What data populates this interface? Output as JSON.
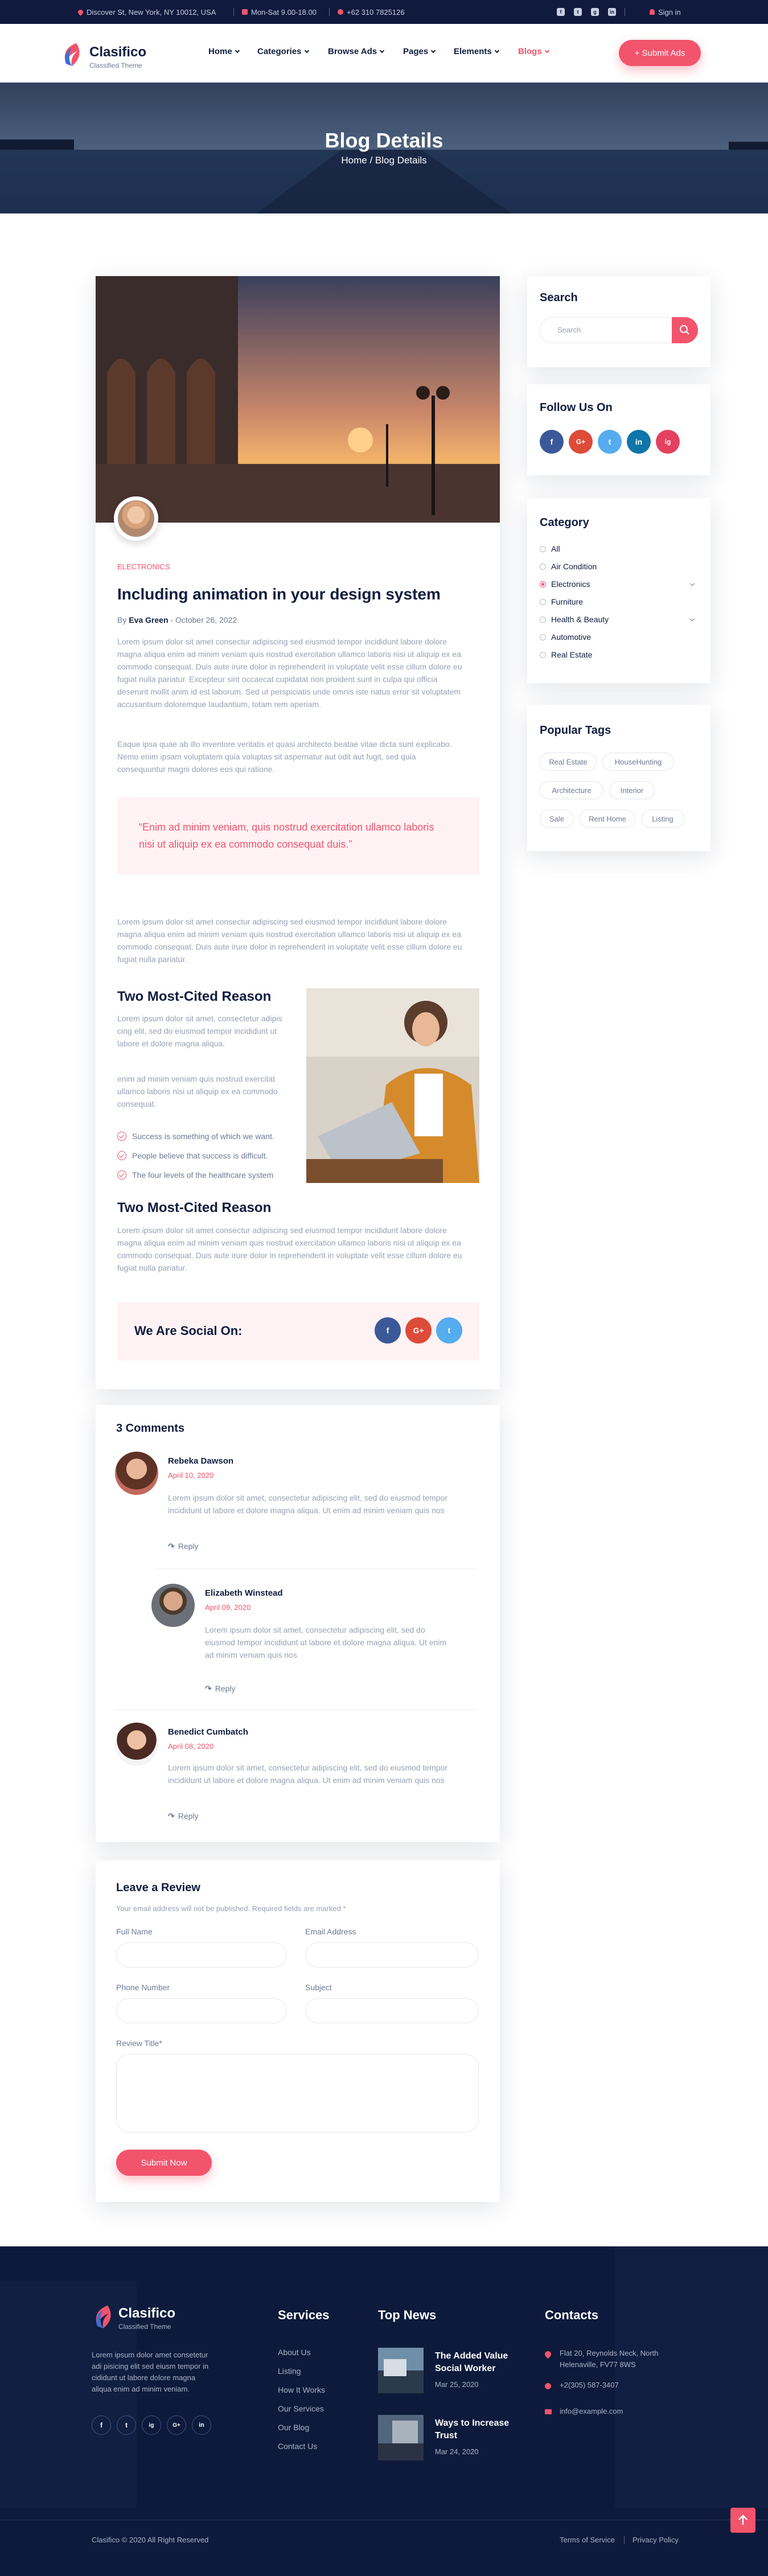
{
  "topbar": {
    "address": "Discover St, New York, NY 10012, USA",
    "hours": "Mon-Sat 9.00-18.00",
    "phone": "+62 310 7825126",
    "signin": "Sign in",
    "social": [
      "f",
      "t",
      "g",
      "in"
    ]
  },
  "brand": {
    "name": "Clasifico",
    "tagline": "Classified Theme"
  },
  "nav": {
    "items": [
      {
        "label": "Home",
        "active": false
      },
      {
        "label": "Categories",
        "active": false
      },
      {
        "label": "Browse Ads",
        "active": false
      },
      {
        "label": "Pages",
        "active": false
      },
      {
        "label": "Elements",
        "active": false
      },
      {
        "label": "Blogs",
        "active": true
      }
    ],
    "submit_label": "+ Submit Ads"
  },
  "banner": {
    "title": "Blog Details",
    "crumb_home": "Home",
    "crumb_sep": "/",
    "crumb_current": "Blog Details"
  },
  "post": {
    "category": "ELECTRONICS",
    "title": "Including animation in your design system",
    "by": "By",
    "author": "Eva Green",
    "date": " - October 26, 2022",
    "para1_lines": [
      "Lorem ipsum dolor sit amet consectur adipiscing sed eiusmod tempor incididunt labore dolore",
      "magna aliqua enim ad minim veniam quis nostrud exercitation ullamco laboris nisi ut aliquip ex ea",
      "commodo consequat. Duis aute irure dolor in reprehenderit in voluptate velit esse cillum dolore eu",
      "fugiat nulla pariatur. Excepteur sint occaecat cupidatat non proident sunt in culpa qui officia",
      "deserunt mollit anim id est laborum. Sed ut perspiciatis unde omnis iste natus error sit voluptatem",
      "accusantium doloremque laudantium, totam rem aperiam."
    ],
    "para2_lines": [
      "Eaque ipsa quae ab illo inventore veritatis et quasi architecto beatae vitae dicta sunt explicabo.",
      "Nemo enim ipsam voluptatem quia voluptas sit aspernatur aut odit aut fugit, sed quia",
      "consequuntur magni dolores eos qui ratione."
    ],
    "quote_lines": [
      "“Enim ad minim veniam, quis nostrud exercitation ullamco laboris",
      "nisi ut aliquip ex ea commodo consequat duis.”"
    ],
    "para3_lines": [
      "Lorem ipsum dolor sit amet consectur adipiscing sed eiusmod tempor incididunt labore dolore",
      "magna aliqua enim ad minim veniam quis nostrud exercitation ullamco laboris nisi ut aliquip ex ea",
      "commodo consequat. Duis aute irure dolor in reprehenderit in voluptate velit esse cillum dolore eu",
      "fugiat nulla pariatur."
    ],
    "section1_title": "Two Most-Cited Reason",
    "section1_p1": [
      "Lorem ipsum dolor sit amet, consectetur adipis",
      "cing elit, sed do eiusmod tempor incididunt ut",
      "labore et dolore magna aliqua."
    ],
    "section1_p2": [
      "enim ad minim veniam quis nostrud exercitat",
      "ullamco laboris nisi ut aliquip ex ea commodo",
      "consequat."
    ],
    "checks": [
      "Success is something of which we want.",
      "People believe that success is difficult.",
      "The four levels of the healthcare system"
    ],
    "section2_title": "Two Most-Cited Reason",
    "para4_lines": [
      "Lorem ipsum dolor sit amet consectur adipiscing sed eiusmod tempor incididunt labore dolore",
      "magna aliqua enim ad minim veniam quis nostrud exercitation ullamco laboris nisi ut aliquip ex ea",
      "commodo consequat. Duis aute irure dolor in reprehenderit in voluptate velit esse cillum dolore eu",
      "fugiat nulla pariatur."
    ],
    "social_title": "We Are Social On:",
    "social": [
      "f",
      "G+",
      "t"
    ]
  },
  "comments": {
    "title": "3 Comments",
    "reply": "Reply",
    "items": [
      {
        "name": "Rebeka Dawson",
        "date": "April 10, 2020",
        "lines": [
          "Lorem ipsum dolor sit amet, consectetur adipiscing elit, sed do eiusmod tempor",
          "incididunt ut labore et dolore magna aliqua. Ut enim ad minim veniam quis nos"
        ]
      },
      {
        "name": "Elizabeth Winstead",
        "date": "April 09, 2020",
        "lines": [
          "Lorem ipsum dolor sit amet, consectetur adipiscing elit, sed do",
          "eiusmod tempor incididunt ut labore et dolore magna aliqua. Ut enim",
          "ad minim veniam quis nos"
        ]
      },
      {
        "name": "Benedict Cumbatch",
        "date": "April 08, 2020",
        "lines": [
          "Lorem ipsum dolor sit amet, consectetur adipiscing elit, sed do eiusmod tempor",
          "incididunt ut labore et dolore magna aliqua. Ut enim ad minim veniam quis nos"
        ]
      }
    ]
  },
  "review": {
    "title": "Leave a Review",
    "note": "Your email address will not be published. Required fields are marked *",
    "full_name": "Full Name",
    "email": "Email Address",
    "phone": "Phone Number",
    "subject": "Subject",
    "review_title": "Review Title*",
    "submit": "Submit Now"
  },
  "sidebar": {
    "search_title": "Search",
    "search_placeholder": "Search",
    "follow_title": "Follow Us On",
    "follow": [
      "f",
      "G+",
      "t",
      "in",
      "ig"
    ],
    "category_title": "Category",
    "categories": [
      {
        "label": "All",
        "active": false,
        "arrow": false
      },
      {
        "label": "Air Condition",
        "active": false,
        "arrow": false
      },
      {
        "label": "Electronics",
        "active": true,
        "arrow": true
      },
      {
        "label": "Furniture",
        "active": false,
        "arrow": false
      },
      {
        "label": "Health & Beauty",
        "active": false,
        "arrow": true
      },
      {
        "label": "Automotive",
        "active": false,
        "arrow": false
      },
      {
        "label": "Real Estate",
        "active": false,
        "arrow": false
      }
    ],
    "tags_title": "Popular Tags",
    "tags": [
      "Real Estate",
      "HouseHunting",
      "Architecture",
      "Interior",
      "Sale",
      "Rent Home",
      "Listing"
    ]
  },
  "footer": {
    "about": [
      "Lorem ipsum dolor amet consetetur",
      "adi pisicing elit sed eiusm tempor in",
      "cididunt ut labore dolore magna",
      "aliqua enim ad minim veniam."
    ],
    "social": [
      "f",
      "t",
      "ig",
      "G+",
      "in"
    ],
    "services_title": "Services",
    "services": [
      "About Us",
      "Listing",
      "How It Works",
      "Our Services",
      "Our Blog",
      "Contact Us"
    ],
    "news_title": "Top News",
    "news": [
      {
        "title_lines": [
          "The Added Value",
          "Social Worker"
        ],
        "date": "Mar 25, 2020"
      },
      {
        "title_lines": [
          "Ways to Increase",
          "Trust"
        ],
        "date": "Mar 24, 2020"
      }
    ],
    "contacts_title": "Contacts",
    "contact_address": [
      "Flat 20, Reynolds Neck, North",
      "Helenaville, FV77 8WS"
    ],
    "contact_phone": "+2(305) 587-3407",
    "contact_email": "info@example.com",
    "copyright": "Clasifico © 2020 All Right Reserved",
    "terms": "Terms of Service",
    "privacy": "Privacy Policy"
  },
  "colors": {
    "accent": "#f2546c",
    "navy": "#0f1d3f",
    "footer_bg": "#0d1a3b"
  }
}
